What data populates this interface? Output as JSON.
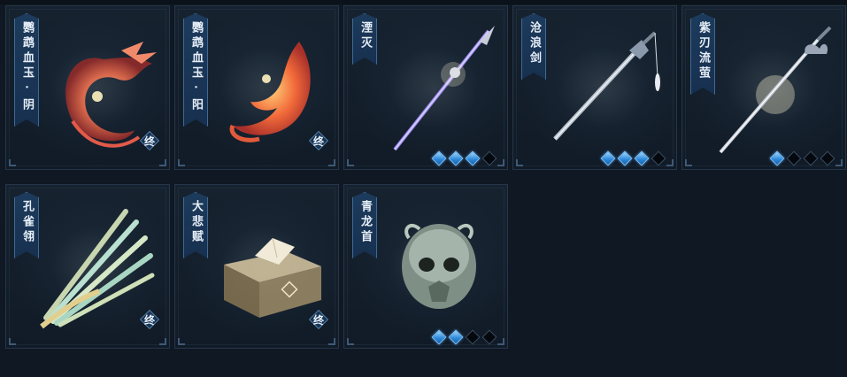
{
  "items": [
    {
      "name": "鹦鹉血玉·阴",
      "art": "phoenix-red-icon",
      "badge": "终",
      "pips": []
    },
    {
      "name": "鹦鹉血玉·阳",
      "art": "phoenix-orange-icon",
      "badge": "终",
      "pips": []
    },
    {
      "name": "湮灭",
      "art": "spear-icon",
      "badge": "",
      "pips": [
        true,
        true,
        true,
        false
      ]
    },
    {
      "name": "沧浪剑",
      "art": "sword-tassel-icon",
      "badge": "",
      "pips": [
        true,
        true,
        true,
        false
      ]
    },
    {
      "name": "紫刃流萤",
      "art": "long-sword-icon",
      "badge": "",
      "pips": [
        true,
        false,
        false,
        false
      ]
    },
    {
      "name": "孔雀翎",
      "art": "peacock-feather-icon",
      "badge": "终",
      "pips": []
    },
    {
      "name": "大悲赋",
      "art": "book-box-icon",
      "badge": "终",
      "pips": []
    },
    {
      "name": "青龙首",
      "art": "dragon-skull-icon",
      "badge": "",
      "pips": [
        true,
        true,
        false,
        false
      ]
    }
  ],
  "colors": {
    "pip_on": "#2a86d8",
    "pip_off": "#05090e",
    "banner": "#1d3b5c",
    "background": "#0f1823"
  }
}
